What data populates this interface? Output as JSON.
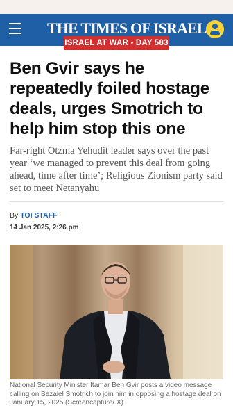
{
  "header": {
    "brand": "THE TIMES OF ISRAEL",
    "war_badge": "ISRAEL AT WAR - DAY 583",
    "colors": {
      "header_bg": "#1f5fa6",
      "badge_bg": "#d32f2f",
      "user_icon": "#f4d33a"
    },
    "icons": {
      "menu": "hamburger-menu-icon",
      "user": "user-account-icon"
    }
  },
  "article": {
    "headline": "Ben Gvir says he repeatedly foiled hostage deals, urges Smotrich to help him stop this one",
    "subhead": "Far-right Otzma Yehudit leader says over the past year ‘we managed to prevent this deal from going ahead, time after time’; Religious Zionism party said set to meet Netanyahu",
    "byline_prefix": "By",
    "author": "TOI STAFF",
    "date": "14 Jan 2025, 2:26 pm",
    "photo_caption": "National Security Minister Itamar Ben Gvir posts a video message calling on Bezalel Smotrich to join him in opposing a hostage deal on January 15, 2025 (Screencapture/ X)"
  }
}
